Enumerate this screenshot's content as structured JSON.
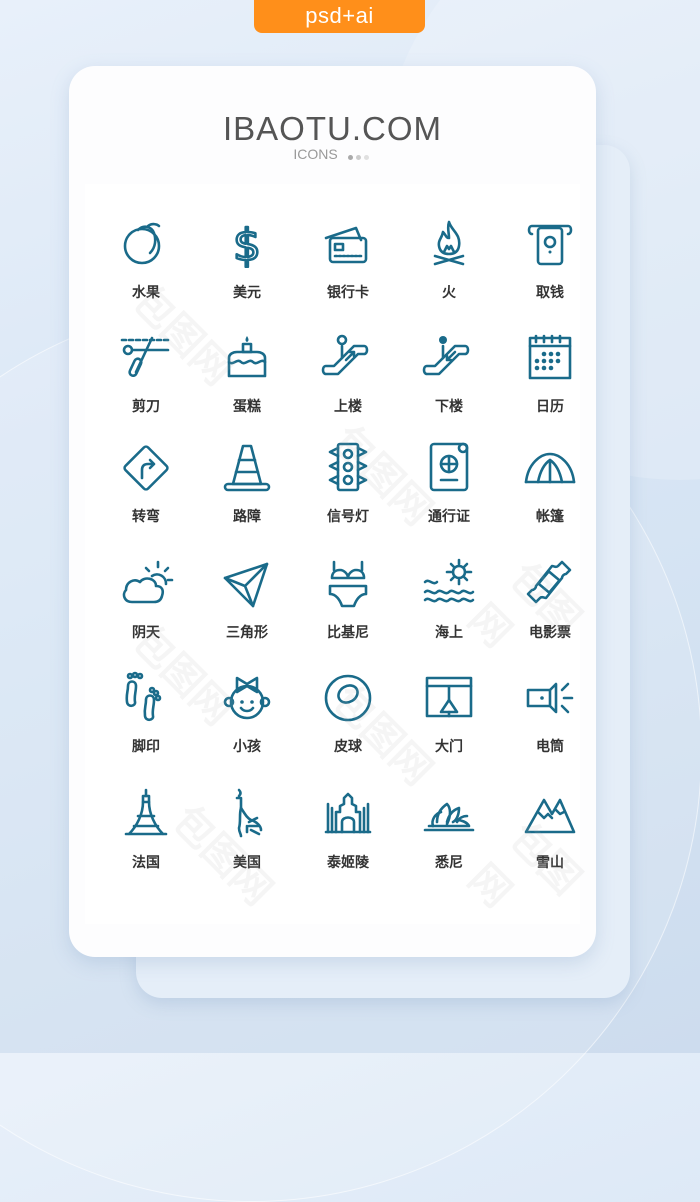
{
  "badge": {
    "label": "psd+ai",
    "color": "#ff8f1a"
  },
  "header": {
    "title": "IBAOTU.COM",
    "subtitle": "ICONS",
    "dot_colors": [
      "#aaaaaa",
      "#cccccc",
      "#e0e0e0"
    ]
  },
  "icon_color": "#1a6b8a",
  "watermark": "包图网",
  "icons": [
    {
      "name": "fruit-icon",
      "label": "水果"
    },
    {
      "name": "dollar-icon",
      "label": "美元"
    },
    {
      "name": "bank-card-icon",
      "label": "银行卡"
    },
    {
      "name": "fire-icon",
      "label": "火"
    },
    {
      "name": "withdraw-money-icon",
      "label": "取钱"
    },
    {
      "name": "scissors-icon",
      "label": "剪刀"
    },
    {
      "name": "cake-icon",
      "label": "蛋糕"
    },
    {
      "name": "escalator-up-icon",
      "label": "上楼"
    },
    {
      "name": "escalator-down-icon",
      "label": "下楼"
    },
    {
      "name": "calendar-icon",
      "label": "日历"
    },
    {
      "name": "turn-sign-icon",
      "label": "转弯"
    },
    {
      "name": "traffic-cone-icon",
      "label": "路障"
    },
    {
      "name": "traffic-light-icon",
      "label": "信号灯"
    },
    {
      "name": "passport-icon",
      "label": "通行证"
    },
    {
      "name": "tent-icon",
      "label": "帐篷"
    },
    {
      "name": "cloudy-icon",
      "label": "阴天"
    },
    {
      "name": "triangle-plane-icon",
      "label": "三角形"
    },
    {
      "name": "bikini-icon",
      "label": "比基尼"
    },
    {
      "name": "sea-sun-icon",
      "label": "海上"
    },
    {
      "name": "movie-ticket-icon",
      "label": "电影票"
    },
    {
      "name": "footprint-icon",
      "label": "脚印"
    },
    {
      "name": "child-icon",
      "label": "小孩"
    },
    {
      "name": "ball-icon",
      "label": "皮球"
    },
    {
      "name": "gate-icon",
      "label": "大门"
    },
    {
      "name": "flashlight-icon",
      "label": "电筒"
    },
    {
      "name": "eiffel-tower-icon",
      "label": "法国"
    },
    {
      "name": "statue-of-liberty-icon",
      "label": "美国"
    },
    {
      "name": "taj-mahal-icon",
      "label": "泰姬陵"
    },
    {
      "name": "sydney-opera-icon",
      "label": "悉尼"
    },
    {
      "name": "snow-mountain-icon",
      "label": "雪山"
    }
  ]
}
